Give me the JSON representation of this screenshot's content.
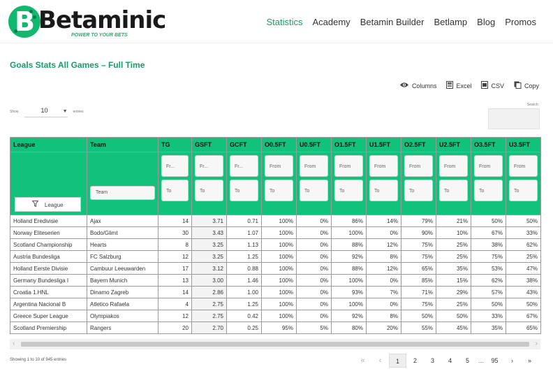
{
  "header": {
    "logo_word": "Betaminic",
    "logo_letter": "B",
    "tagline": "POWER TO YOUR BETS",
    "nav": [
      "Statistics",
      "Academy",
      "Betamin Builder",
      "Betlamp",
      "Blog",
      "Promos"
    ],
    "active_nav": "Statistics"
  },
  "page_title": "Goals Stats All Games – Full Time",
  "tools": {
    "columns": "Columns",
    "excel": "Excel",
    "csv": "CSV",
    "copy": "Copy"
  },
  "show": {
    "label": "Show",
    "value": "10",
    "suffix": "entries"
  },
  "search_label": "Search:",
  "table": {
    "columns": [
      "League",
      "Team",
      "TG",
      "GSFT",
      "GCFT",
      "O0.5FT",
      "U0.5FT",
      "O1.5FT",
      "U1.5FT",
      "O2.5FT",
      "U2.5FT",
      "O3.5FT",
      "U3.5FT"
    ],
    "filters": {
      "league_button": "League",
      "team_placeholder": "Team",
      "from_short": "Fr...",
      "from": "From",
      "to": "To"
    },
    "rows": [
      [
        "Holland Eredivisie",
        "Ajax",
        "14",
        "3.71",
        "0.71",
        "100%",
        "0%",
        "86%",
        "14%",
        "79%",
        "21%",
        "50%",
        "50%"
      ],
      [
        "Norway Eliteserien",
        "Bodo/Glimt",
        "30",
        "3.43",
        "1.07",
        "100%",
        "0%",
        "100%",
        "0%",
        "90%",
        "10%",
        "67%",
        "33%"
      ],
      [
        "Scotland Championship",
        "Hearts",
        "8",
        "3.25",
        "1.13",
        "100%",
        "0%",
        "88%",
        "12%",
        "75%",
        "25%",
        "38%",
        "62%"
      ],
      [
        "Austria Bundesliga",
        "FC Salzburg",
        "12",
        "3.25",
        "1.25",
        "100%",
        "0%",
        "92%",
        "8%",
        "75%",
        "25%",
        "75%",
        "25%"
      ],
      [
        "Holland Eerste Divisie",
        "Cambuur Leeuwarden",
        "17",
        "3.12",
        "0.88",
        "100%",
        "0%",
        "88%",
        "12%",
        "65%",
        "35%",
        "53%",
        "47%"
      ],
      [
        "Germany Bundesliga I",
        "Bayern Munich",
        "13",
        "3.00",
        "1.46",
        "100%",
        "0%",
        "100%",
        "0%",
        "85%",
        "15%",
        "62%",
        "38%"
      ],
      [
        "Croatia 1.HNL",
        "Dinamo Zagreb",
        "14",
        "2.86",
        "1.00",
        "100%",
        "0%",
        "93%",
        "7%",
        "71%",
        "29%",
        "57%",
        "43%"
      ],
      [
        "Argentina Nacional B",
        "Atletico Rafaela",
        "4",
        "2.75",
        "1.25",
        "100%",
        "0%",
        "100%",
        "0%",
        "75%",
        "25%",
        "50%",
        "50%"
      ],
      [
        "Greece Super League",
        "Olympiakos",
        "12",
        "2.75",
        "0.42",
        "100%",
        "0%",
        "92%",
        "8%",
        "50%",
        "50%",
        "33%",
        "67%"
      ],
      [
        "Scotland Premiership",
        "Rangers",
        "20",
        "2.70",
        "0.25",
        "95%",
        "5%",
        "80%",
        "20%",
        "55%",
        "45%",
        "35%",
        "65%"
      ]
    ]
  },
  "info": "Showing 1 to 10 of 945 entries",
  "pager": {
    "first": "«",
    "prev": "‹",
    "pages": [
      "1",
      "2",
      "3",
      "4",
      "5"
    ],
    "ellipsis": "…",
    "last_page": "95",
    "next": "›",
    "last": "»",
    "current": "1"
  }
}
